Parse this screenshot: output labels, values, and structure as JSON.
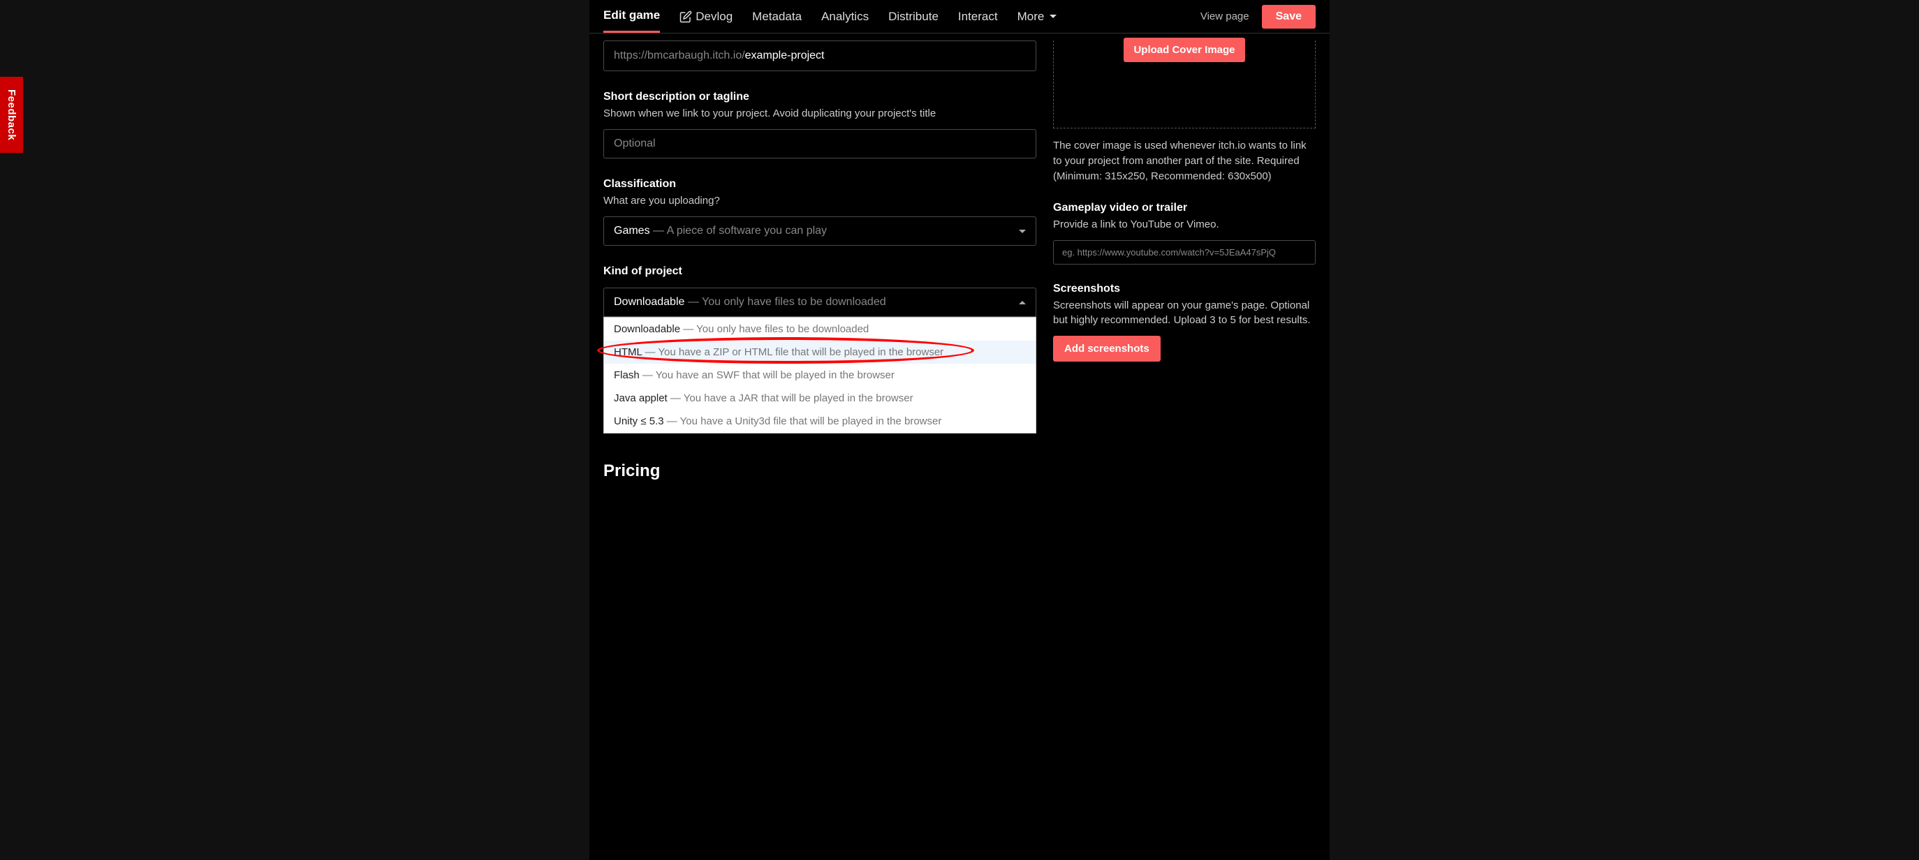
{
  "nav": {
    "tabs": [
      "Edit game",
      "Devlog",
      "Metadata",
      "Analytics",
      "Distribute",
      "Interact",
      "More"
    ],
    "view_page": "View page",
    "save": "Save"
  },
  "feedback": "Feedback",
  "url": {
    "prefix": "https://bmcarbaugh.itch.io/",
    "slug": "example-project"
  },
  "short_desc": {
    "label": "Short description or tagline",
    "hint": "Shown when we link to your project. Avoid duplicating your project's title",
    "placeholder": "Optional"
  },
  "classification": {
    "label": "Classification",
    "hint": "What are you uploading?",
    "value": "Games",
    "value_desc": " — A piece of software you can play"
  },
  "kind": {
    "label": "Kind of project",
    "value": "Downloadable",
    "value_desc": " — You only have files to be downloaded",
    "options": [
      {
        "name": "Downloadable",
        "desc": " — You only have files to be downloaded"
      },
      {
        "name": "HTML",
        "desc": " — You have a ZIP or HTML file that will be played in the browser"
      },
      {
        "name": "Flash",
        "desc": " — You have an SWF that will be played in the browser"
      },
      {
        "name": "Java applet",
        "desc": " — You have a JAR that will be played in the browser"
      },
      {
        "name": "Unity ≤ 5.3",
        "desc": " — You have a Unity3d file that will be played in the browser"
      }
    ]
  },
  "pricing": {
    "heading": "Pricing"
  },
  "cover": {
    "button": "Upload Cover Image",
    "hint": "The cover image is used whenever itch.io wants to link to your project from another part of the site. Required (Minimum: 315x250, Recommended: 630x500)"
  },
  "video": {
    "label": "Gameplay video or trailer",
    "hint": "Provide a link to YouTube or Vimeo.",
    "placeholder": "eg. https://www.youtube.com/watch?v=5JEaA47sPjQ"
  },
  "screenshots": {
    "label": "Screenshots",
    "hint": "Screenshots will appear on your game's page. Optional but highly recommended. Upload 3 to 5 for best results.",
    "button": "Add screenshots"
  }
}
